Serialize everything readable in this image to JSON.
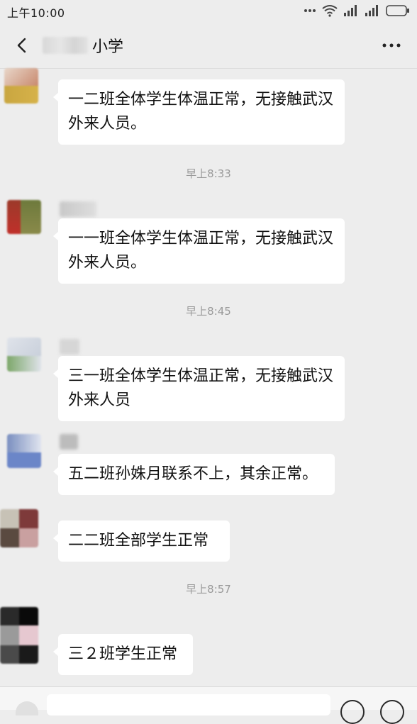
{
  "status_bar": {
    "time": "上午10:00"
  },
  "header": {
    "title": "小学",
    "back_icon": "chevron-left-icon",
    "more_icon": "more-dots-icon"
  },
  "messages": [
    {
      "text": "一二班全体学生体温正常，无接触武汉外来人员。"
    },
    {
      "text": "一一班全体学生体温正常，无接触武汉外来人员。"
    },
    {
      "text": "三一班全体学生体温正常，无接触武汉外来人员"
    },
    {
      "text": "五二班孙姝月联系不上，其余正常。"
    },
    {
      "text": "二二班全部学生正常"
    },
    {
      "text": "三２班学生正常"
    }
  ],
  "timestamps": [
    "早上8:33",
    "早上8:45",
    "早上8:57"
  ],
  "input_bar": {
    "placeholder": "",
    "icons": [
      "voice-icon",
      "emoji-icon",
      "add-icon"
    ]
  },
  "colors": {
    "background": "#ededed",
    "bubble": "#ffffff",
    "timestamp": "#9a9a9a"
  }
}
